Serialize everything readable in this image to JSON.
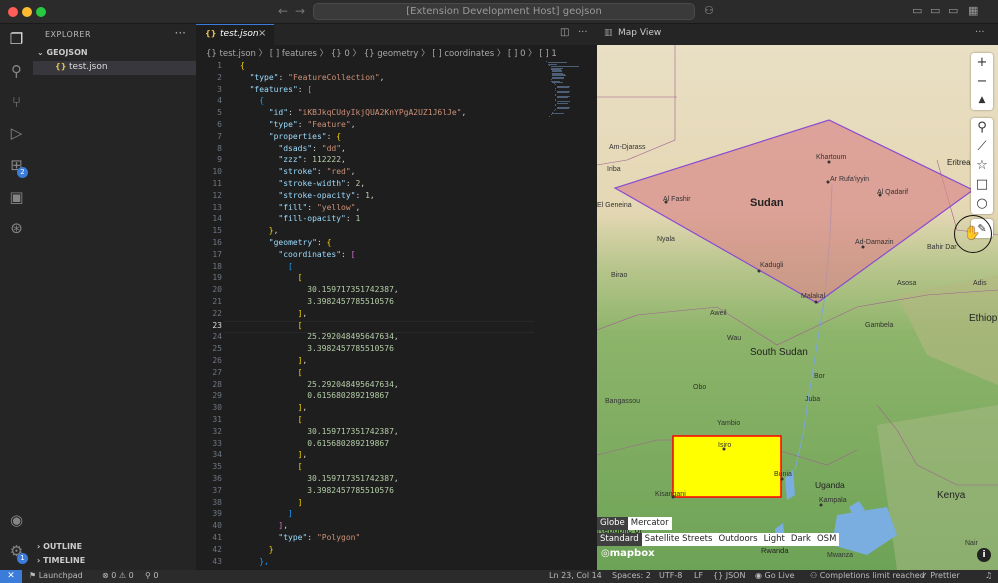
{
  "titlebar": {
    "search_text": "[Extension Development Host] geojson"
  },
  "colors": {
    "accent": "#3b7bd9",
    "polygon_red_fill": "#d98a8a",
    "polygon_red_stroke": "#8a4bd0",
    "polygon_yellow_fill": "#ffff00",
    "polygon_yellow_stroke": "#ff0000",
    "json_key": "#9cdcfe",
    "json_string": "#ce9178",
    "json_number": "#b5cea8"
  },
  "activity_bar": {
    "items": [
      {
        "name": "explorer-icon",
        "glyph": "❐"
      },
      {
        "name": "search-icon",
        "glyph": "⚲"
      },
      {
        "name": "source-control-icon",
        "glyph": "⑂"
      },
      {
        "name": "run-debug-icon",
        "glyph": "▷"
      },
      {
        "name": "extensions-icon",
        "glyph": "⊞",
        "badge": "2"
      },
      {
        "name": "remote-explorer-icon",
        "glyph": "▣"
      },
      {
        "name": "gitlens-icon",
        "glyph": "⊛"
      }
    ],
    "bottom": [
      {
        "name": "account-icon",
        "glyph": "◉"
      },
      {
        "name": "settings-gear-icon",
        "glyph": "⚙",
        "badge": "1"
      }
    ]
  },
  "sidebar": {
    "title": "EXPLORER",
    "folder": "GEOJSON",
    "file": "test.json",
    "file_icon": "{}",
    "outline": "OUTLINE",
    "timeline": "TIMELINE"
  },
  "editor": {
    "tab_label": "test.json",
    "tab_icon": "{}",
    "breadcrumb": "{} test.json  〉 [ ] features  〉 {} 0  〉 {} geometry  〉 [ ] coordinates  〉 [ ] 0  〉 [ ] 1",
    "current_line": 23,
    "lines": [
      {
        "n": "1",
        "i": 0,
        "t": [
          [
            "br1",
            "{"
          ]
        ]
      },
      {
        "n": "2",
        "i": 1,
        "t": [
          [
            "key",
            "\"type\""
          ],
          [
            "pun",
            ": "
          ],
          [
            "str",
            "\"FeatureCollection\""
          ],
          [
            "pun",
            ","
          ]
        ]
      },
      {
        "n": "3",
        "i": 1,
        "t": [
          [
            "key",
            "\"features\""
          ],
          [
            "pun",
            ": "
          ],
          [
            "br2",
            "["
          ]
        ]
      },
      {
        "n": "4",
        "i": 2,
        "t": [
          [
            "br3",
            "{"
          ]
        ]
      },
      {
        "n": "5",
        "i": 3,
        "t": [
          [
            "key",
            "\"id\""
          ],
          [
            "pun",
            ": "
          ],
          [
            "str",
            "\"iKBJkqCUdyIkjQUA2KnYPgA2UZ1J6lJe\""
          ],
          [
            "pun",
            ","
          ]
        ]
      },
      {
        "n": "6",
        "i": 3,
        "t": [
          [
            "key",
            "\"type\""
          ],
          [
            "pun",
            ": "
          ],
          [
            "str",
            "\"Feature\""
          ],
          [
            "pun",
            ","
          ]
        ]
      },
      {
        "n": "7",
        "i": 3,
        "t": [
          [
            "key",
            "\"properties\""
          ],
          [
            "pun",
            ": "
          ],
          [
            "br1",
            "{"
          ]
        ]
      },
      {
        "n": "8",
        "i": 4,
        "t": [
          [
            "key",
            "\"dsads\""
          ],
          [
            "pun",
            ": "
          ],
          [
            "str",
            "\"dd\""
          ],
          [
            "pun",
            ","
          ]
        ]
      },
      {
        "n": "9",
        "i": 4,
        "t": [
          [
            "key",
            "\"zzz\""
          ],
          [
            "pun",
            ": "
          ],
          [
            "num",
            "112222"
          ],
          [
            "pun",
            ","
          ]
        ]
      },
      {
        "n": "10",
        "i": 4,
        "t": [
          [
            "key",
            "\"stroke\""
          ],
          [
            "pun",
            ": "
          ],
          [
            "str",
            "\"red\""
          ],
          [
            "pun",
            ","
          ]
        ]
      },
      {
        "n": "11",
        "i": 4,
        "t": [
          [
            "key",
            "\"stroke-width\""
          ],
          [
            "pun",
            ": "
          ],
          [
            "num",
            "2"
          ],
          [
            "pun",
            ","
          ]
        ]
      },
      {
        "n": "12",
        "i": 4,
        "t": [
          [
            "key",
            "\"stroke-opacity\""
          ],
          [
            "pun",
            ": "
          ],
          [
            "num",
            "1"
          ],
          [
            "pun",
            ","
          ]
        ]
      },
      {
        "n": "13",
        "i": 4,
        "t": [
          [
            "key",
            "\"fill\""
          ],
          [
            "pun",
            ": "
          ],
          [
            "str",
            "\"yellow\""
          ],
          [
            "pun",
            ","
          ]
        ]
      },
      {
        "n": "14",
        "i": 4,
        "t": [
          [
            "key",
            "\"fill-opacity\""
          ],
          [
            "pun",
            ": "
          ],
          [
            "num",
            "1"
          ]
        ]
      },
      {
        "n": "15",
        "i": 3,
        "t": [
          [
            "br1",
            "}"
          ],
          [
            "pun",
            ","
          ]
        ]
      },
      {
        "n": "16",
        "i": 3,
        "t": [
          [
            "key",
            "\"geometry\""
          ],
          [
            "pun",
            ": "
          ],
          [
            "br1",
            "{"
          ]
        ]
      },
      {
        "n": "17",
        "i": 4,
        "t": [
          [
            "key",
            "\"coordinates\""
          ],
          [
            "pun",
            ": "
          ],
          [
            "br2",
            "["
          ]
        ]
      },
      {
        "n": "18",
        "i": 5,
        "t": [
          [
            "br3",
            "["
          ]
        ]
      },
      {
        "n": "19",
        "i": 6,
        "t": [
          [
            "br1",
            "["
          ]
        ]
      },
      {
        "n": "20",
        "i": 7,
        "t": [
          [
            "num",
            "30.159717351742387"
          ],
          [
            "pun",
            ","
          ]
        ]
      },
      {
        "n": "21",
        "i": 7,
        "t": [
          [
            "num",
            "3.3982457785510576"
          ]
        ]
      },
      {
        "n": "22",
        "i": 6,
        "t": [
          [
            "br1",
            "]"
          ],
          [
            "pun",
            ","
          ]
        ]
      },
      {
        "n": "23",
        "i": 6,
        "t": [
          [
            "br1",
            "["
          ]
        ]
      },
      {
        "n": "24",
        "i": 7,
        "t": [
          [
            "num",
            "25.292048495647634"
          ],
          [
            "pun",
            ","
          ]
        ]
      },
      {
        "n": "25",
        "i": 7,
        "t": [
          [
            "num",
            "3.3982457785510576"
          ]
        ]
      },
      {
        "n": "26",
        "i": 6,
        "t": [
          [
            "br1",
            "]"
          ],
          [
            "pun",
            ","
          ]
        ]
      },
      {
        "n": "27",
        "i": 6,
        "t": [
          [
            "br1",
            "["
          ]
        ]
      },
      {
        "n": "28",
        "i": 7,
        "t": [
          [
            "num",
            "25.292048495647634"
          ],
          [
            "pun",
            ","
          ]
        ]
      },
      {
        "n": "29",
        "i": 7,
        "t": [
          [
            "num",
            "0.615680289219867"
          ]
        ]
      },
      {
        "n": "30",
        "i": 6,
        "t": [
          [
            "br1",
            "]"
          ],
          [
            "pun",
            ","
          ]
        ]
      },
      {
        "n": "31",
        "i": 6,
        "t": [
          [
            "br1",
            "["
          ]
        ]
      },
      {
        "n": "32",
        "i": 7,
        "t": [
          [
            "num",
            "30.159717351742387"
          ],
          [
            "pun",
            ","
          ]
        ]
      },
      {
        "n": "33",
        "i": 7,
        "t": [
          [
            "num",
            "0.615680289219867"
          ]
        ]
      },
      {
        "n": "34",
        "i": 6,
        "t": [
          [
            "br1",
            "]"
          ],
          [
            "pun",
            ","
          ]
        ]
      },
      {
        "n": "35",
        "i": 6,
        "t": [
          [
            "br1",
            "["
          ]
        ]
      },
      {
        "n": "36",
        "i": 7,
        "t": [
          [
            "num",
            "30.159717351742387"
          ],
          [
            "pun",
            ","
          ]
        ]
      },
      {
        "n": "37",
        "i": 7,
        "t": [
          [
            "num",
            "3.3982457785510576"
          ]
        ]
      },
      {
        "n": "38",
        "i": 6,
        "t": [
          [
            "br1",
            "]"
          ]
        ]
      },
      {
        "n": "39",
        "i": 5,
        "t": [
          [
            "br3",
            "]"
          ]
        ]
      },
      {
        "n": "40",
        "i": 4,
        "t": [
          [
            "br2",
            "]"
          ],
          [
            "pun",
            ","
          ]
        ]
      },
      {
        "n": "41",
        "i": 4,
        "t": [
          [
            "key",
            "\"type\""
          ],
          [
            "pun",
            ": "
          ],
          [
            "str",
            "\"Polygon\""
          ]
        ]
      },
      {
        "n": "42",
        "i": 3,
        "t": [
          [
            "br1",
            "}"
          ]
        ]
      },
      {
        "n": "43",
        "i": 2,
        "t": [
          [
            "br3",
            "},"
          ]
        ]
      }
    ]
  },
  "map": {
    "tab_label": "Map View",
    "labels": {
      "sudan": "Sudan",
      "south_sudan": "South Sudan",
      "ethiopia": "Ethiop",
      "eritrea": "Eritrea",
      "kenya": "Kenya",
      "uganda": "Uganda",
      "rwanda": "Rwanda",
      "drc": "Republic of",
      "khartoum": "Khartoum",
      "ar_rufaa": "Ar Rufa'iyyin",
      "al_qadarif": "Al Qadarif",
      "al_fashir": "Al Fashir",
      "am_djarass": "Am-Djarass",
      "iriba": "Iriba",
      "el_geneina": "El Geneina",
      "ad_damazin": "Ad-Damazin",
      "bahir_dar": "Bahir Dar",
      "kadugli": "Kadugli",
      "malakal": "Malakal",
      "nyala": "Nyala",
      "birao": "Birao",
      "aweil": "Aweil",
      "wau": "Wau",
      "gambela": "Gambela",
      "bor": "Bor",
      "yambio": "Yambio",
      "juba": "Juba",
      "obo": "Obo",
      "bangassou": "Bangassou",
      "isiro": "Isiro",
      "bunia": "Bunia",
      "kisangani": "Kisangani",
      "kampala": "Kampala",
      "mwanza": "Mwanza",
      "nairobi": "Nair",
      "addis": "Adis",
      "asosa": "Asosa"
    },
    "controls": {
      "zoom_in": "+",
      "zoom_out": "−",
      "compass": "▲",
      "draw_point": "⚲",
      "draw_line": "⟋",
      "draw_star": "☆",
      "draw_rect": "□",
      "draw_circle": "○",
      "edit": "✎"
    },
    "projection_options": [
      "Globe",
      "Mercator"
    ],
    "selected_projection": "Globe",
    "style_options": [
      "Standard",
      "Satellite Streets",
      "Outdoors",
      "Light",
      "Dark",
      "OSM"
    ],
    "selected_style": "Standard",
    "logo": "mapbox",
    "info": "i"
  },
  "statusbar": {
    "branch": "Launchpad",
    "errors": "0",
    "warnings": "0",
    "ports": "0",
    "position": "Ln 23, Col 14",
    "spaces": "Spaces: 2",
    "encoding": "UTF-8",
    "eol": "LF",
    "language": "{} JSON",
    "golive": "Go Live",
    "completions": "Completions limit reached",
    "prettier": "Prettier"
  }
}
